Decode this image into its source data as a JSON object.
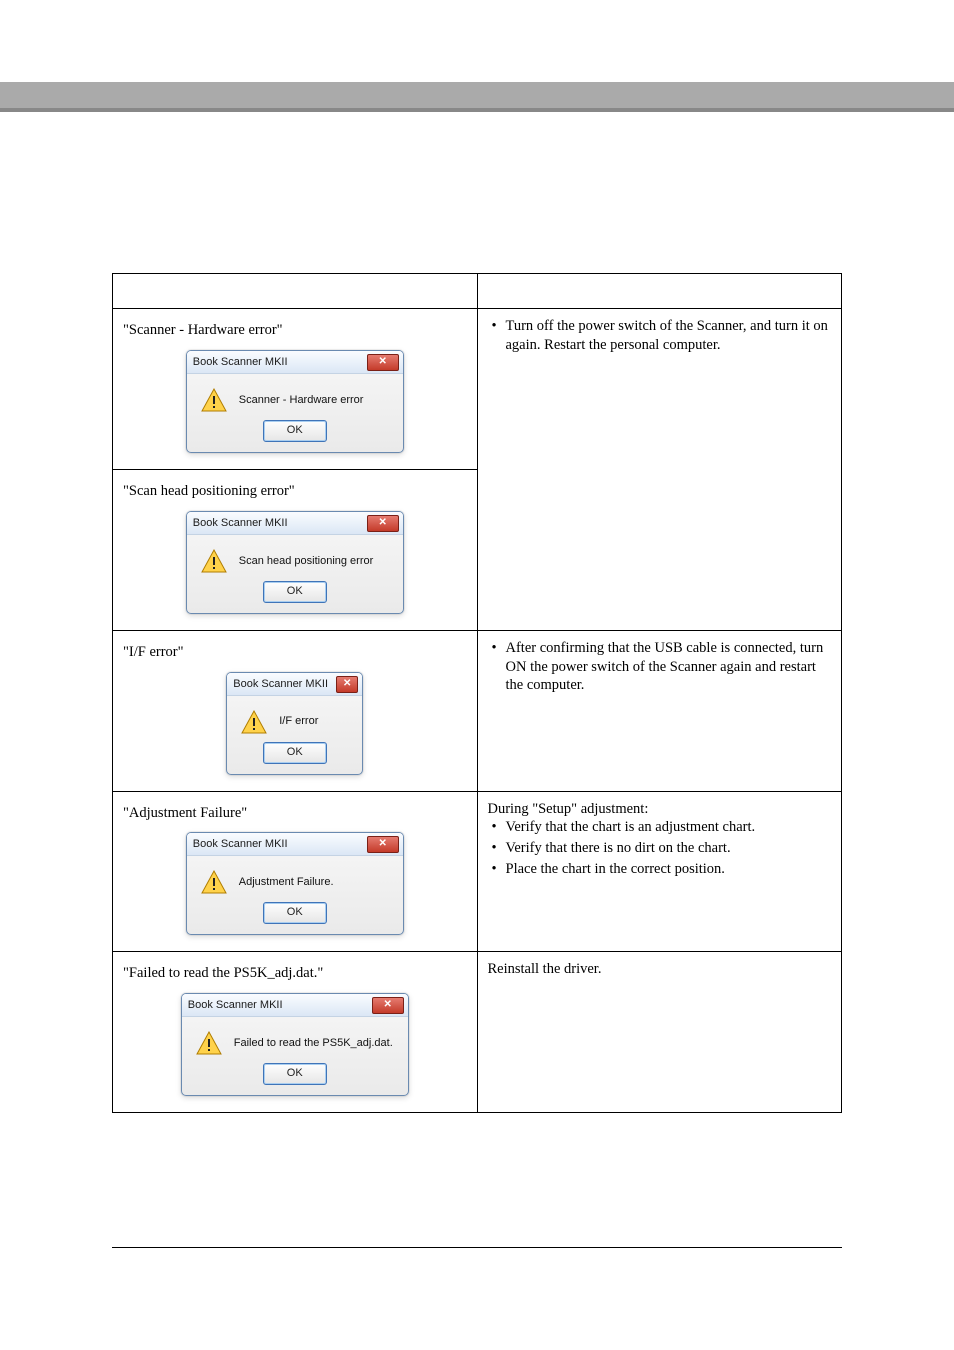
{
  "dialog_title": "Book Scanner MKII",
  "ok_label": "OK",
  "rows": [
    {
      "label_prefix": "\"",
      "label": "Scanner - Hardware error",
      "label_suffix": "\"",
      "msg": "Scanner - Hardware error",
      "remedy_lead": "",
      "remedy_items": [
        "Turn off the power switch of the Scanner, and turn it on again. Restart the personal computer."
      ],
      "dialog_class": "wide",
      "close_class": ""
    },
    {
      "label_prefix": "\"",
      "label": "Scan head positioning error",
      "label_suffix": "\"",
      "msg": "Scan head positioning error",
      "dialog_class": "wide",
      "close_class": ""
    },
    {
      "label_prefix": "\"",
      "label": "I/F error",
      "label_suffix": "\"",
      "msg": "I/F error",
      "remedy_items": [
        "After confirming that the USB cable is connected, turn ON the power switch of the Scanner again and restart the computer."
      ],
      "dialog_class": "narrow",
      "close_class": "sm"
    },
    {
      "label_prefix": "\"",
      "label": "Adjustment Failure",
      "label_suffix": "\"",
      "msg": "Adjustment Failure.",
      "remedy_lead": "During \"Setup\" adjustment:",
      "remedy_items": [
        "Verify that the chart is an adjustment chart.",
        "Verify that there is no dirt on the chart.",
        "Place the chart in the correct position."
      ],
      "dialog_class": "wide",
      "close_class": ""
    },
    {
      "label_prefix": "\"",
      "label": "Failed to read the PS5K_adj.dat.",
      "label_suffix": "\"",
      "msg": "Failed to read the PS5K_adj.dat.",
      "remedy_lead": "Reinstall the driver.",
      "remedy_items": [],
      "dialog_class": "mid",
      "close_class": ""
    }
  ]
}
